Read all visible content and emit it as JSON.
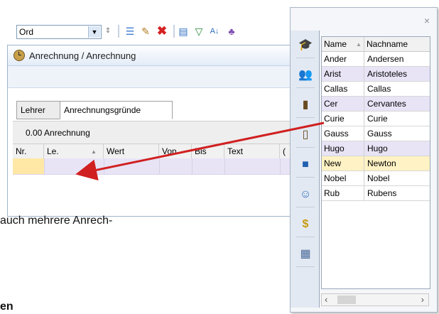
{
  "window": {
    "title": "Anrechnung / Anrechnung",
    "combo_value": "Ord",
    "tabs": [
      "Lehrer",
      "Anrechnungsgründe"
    ],
    "summary": "0.00 Anrechnung",
    "columns": [
      "Nr.",
      "Le.",
      "Wert",
      "Von",
      "Bis",
      "Text",
      "("
    ]
  },
  "toolbar_icons": [
    "combo-arrow-icon",
    "spinner-icon",
    "list-icon",
    "new-doc-icon",
    "delete-icon",
    "report-icon",
    "filter-icon",
    "sort-icon",
    "people-icon"
  ],
  "doc_text": {
    "line1": "auch mehrere Anrech-",
    "line2": "en"
  },
  "panel": {
    "close": "×",
    "columns": [
      "Name",
      "Nachname"
    ],
    "rows": [
      {
        "name": "Ander",
        "surname": "Andersen"
      },
      {
        "name": "Arist",
        "surname": "Aristoteles"
      },
      {
        "name": "Callas",
        "surname": "Callas"
      },
      {
        "name": "Cer",
        "surname": "Cervantes"
      },
      {
        "name": "Curie",
        "surname": "Curie"
      },
      {
        "name": "Gauss",
        "surname": "Gauss"
      },
      {
        "name": "Hugo",
        "surname": "Hugo"
      },
      {
        "name": "New",
        "surname": "Newton"
      },
      {
        "name": "Nobel",
        "surname": "Nobel"
      },
      {
        "name": "Rub",
        "surname": "Rubens"
      }
    ],
    "sidebar_icons": [
      "graduation-cap-icon",
      "group-icon",
      "door-icon",
      "room-icon",
      "book-icon",
      "person-icon",
      "dollar-icon",
      "table-icon"
    ]
  },
  "colors": {
    "row_lavender": "#e8e4f6",
    "row_selected": "#ffe8a6",
    "arrow": "#d02020"
  }
}
